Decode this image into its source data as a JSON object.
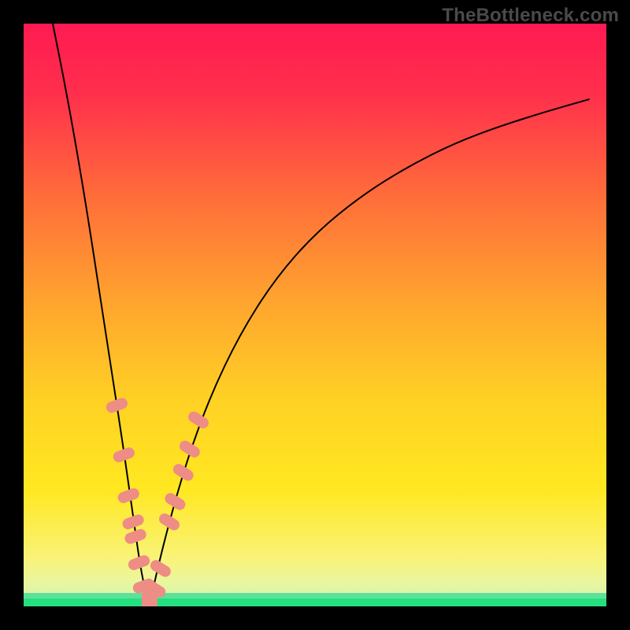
{
  "watermark": {
    "text": "TheBottleneck.com"
  },
  "chart_data": {
    "type": "line",
    "title": "",
    "xlabel": "",
    "ylabel": "",
    "xlim": [
      0,
      100
    ],
    "ylim": [
      0,
      100
    ],
    "grid": false,
    "legend": false,
    "annotations": [],
    "background_gradient": {
      "top_color": "#ff1a52",
      "mid_color": "#ffe821",
      "green_band_color": "#24e07e",
      "green_band_y_range": [
        0,
        2.5
      ]
    },
    "series": [
      {
        "name": "bottleneck-curve",
        "shape": "V",
        "minimum": {
          "x": 21.5,
          "y": 0
        },
        "color": "#000000",
        "stroke_width": 2,
        "x": [
          5.0,
          7.0,
          9.0,
          11.0,
          13.0,
          15.0,
          17.0,
          19.0,
          20.0,
          21.0,
          21.5,
          22.0,
          23.0,
          25.0,
          28.0,
          32.0,
          37.0,
          43.0,
          50.0,
          58.0,
          66.0,
          74.0,
          82.0,
          90.0,
          97.0
        ],
        "values": [
          100,
          90.0,
          79.0,
          67.0,
          54.0,
          41.0,
          28.0,
          14.0,
          7.0,
          2.0,
          0.0,
          2.0,
          6.5,
          14.5,
          25.0,
          36.0,
          46.5,
          56.0,
          64.0,
          70.5,
          75.5,
          79.5,
          82.5,
          85.0,
          87.0
        ]
      }
    ],
    "markers": {
      "shape": "rounded-capsule",
      "color": "#ed8d85",
      "placement_note": "along lower part of curve, both arms, near bottom",
      "points": [
        {
          "x": 16.0,
          "y": 34.5
        },
        {
          "x": 17.2,
          "y": 26.0
        },
        {
          "x": 18.0,
          "y": 19.0
        },
        {
          "x": 18.8,
          "y": 14.5
        },
        {
          "x": 19.2,
          "y": 12.0
        },
        {
          "x": 19.8,
          "y": 7.5
        },
        {
          "x": 20.6,
          "y": 3.5
        },
        {
          "x": 21.2,
          "y": 1.0
        },
        {
          "x": 22.0,
          "y": 1.0
        },
        {
          "x": 22.6,
          "y": 3.0
        },
        {
          "x": 23.5,
          "y": 6.5
        },
        {
          "x": 25.0,
          "y": 14.5
        },
        {
          "x": 26.0,
          "y": 18.0
        },
        {
          "x": 27.4,
          "y": 23.0
        },
        {
          "x": 28.5,
          "y": 27.0
        },
        {
          "x": 30.0,
          "y": 32.0
        }
      ]
    }
  }
}
